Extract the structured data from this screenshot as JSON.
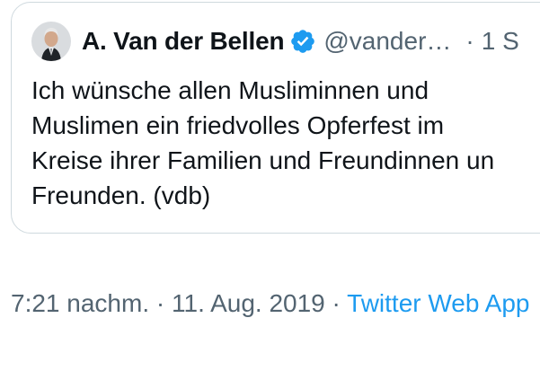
{
  "quoted_tweet": {
    "author_name": "A. Van der Bellen",
    "handle": "@vander…",
    "separator": "·",
    "time_short": "1 S",
    "text_lines": [
      "Ich wünsche allen Musliminnen und",
      "Muslimen ein friedvolles Opferfest im",
      "Kreise ihrer Familien und Freundinnen un",
      "Freunden. (vdb)"
    ],
    "avatar_icon": "person-portrait-icon",
    "verified_icon": "verified-badge-icon"
  },
  "tweet_meta": {
    "time": "7:21 nachm.",
    "separator1": " · ",
    "date": "11. Aug. 2019",
    "separator2": " · ",
    "source": "Twitter Web App"
  },
  "colors": {
    "text_primary": "#0f1419",
    "text_secondary": "#536471",
    "accent_blue": "#1d9bf0",
    "border": "#cfd9de"
  }
}
